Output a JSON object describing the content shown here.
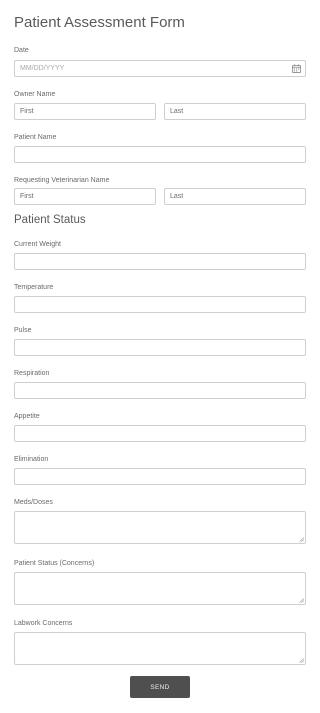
{
  "form": {
    "title": "Patient Assessment Form",
    "date": {
      "label": "Date",
      "placeholder": "MM/DD/YYYY",
      "icon": "calendar-icon"
    },
    "owner_name": {
      "label": "Owner Name",
      "first": "First",
      "last": "Last"
    },
    "patient_name": {
      "label": "Patient Name",
      "value": ""
    },
    "requesting_vet": {
      "label": "Requesting Veterinarian Name",
      "first": "First",
      "last": "Last"
    },
    "patient_status_title": "Patient Status",
    "fields": {
      "current_weight": "Current Weight",
      "temperature": "Temperature",
      "pulse": "Pulse",
      "respiration": "Respiration",
      "appetite": "Appetite",
      "elimination": "Elimination",
      "meds_doses": "Meds/Doses",
      "patient_status_concerns": "Patient Status (Concerns)",
      "labwork_concerns": "Labwork Concerns"
    },
    "send_label": "SEND"
  }
}
